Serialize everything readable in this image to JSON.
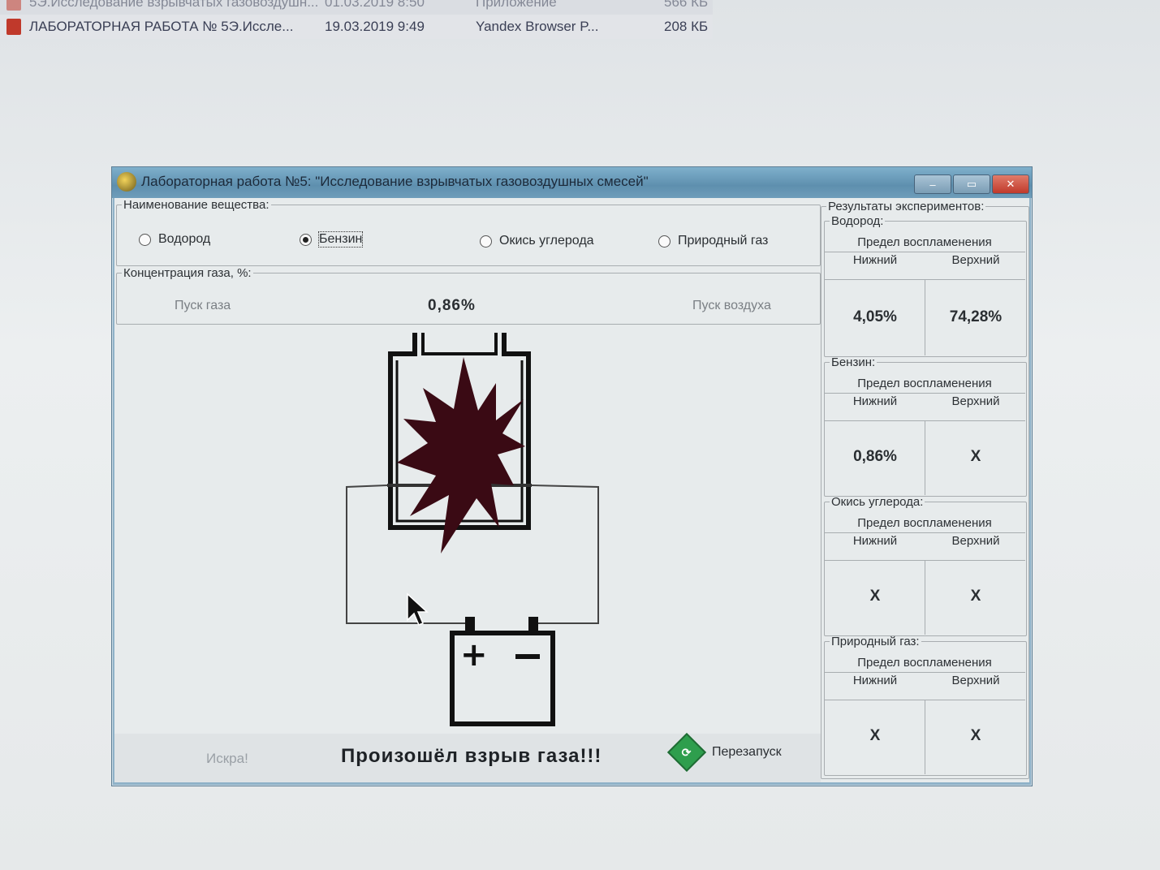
{
  "bg_files": [
    {
      "name": "5Э.Исследование взрывчатых газовоздушн...",
      "date": "01.03.2019 8:50",
      "type": "Приложение",
      "size": "566 КБ"
    },
    {
      "name": "ЛАБОРАТОРНАЯ РАБОТА № 5Э.Иссле...",
      "date": "19.03.2019 9:49",
      "type": "Yandex Browser P...",
      "size": "208 КБ"
    }
  ],
  "window": {
    "title": "Лабораторная работа №5: \"Исследование взрывчатых газовоздушных смесей\"",
    "min": "–",
    "max": "▭",
    "close": "✕"
  },
  "substance": {
    "legend": "Наименование вещества:",
    "options": [
      "Водород",
      "Бензин",
      "Окись углерода",
      "Природный газ"
    ],
    "selected": 1
  },
  "concentration": {
    "legend": "Концентрация газа, %:",
    "gas_button": "Пуск газа",
    "value": "0,86%",
    "air_button": "Пуск воздуха"
  },
  "bottom": {
    "spark": "Искра!",
    "message": "Произошёл взрыв газа!!!",
    "restart": "Перезапуск"
  },
  "results": {
    "legend": "Результаты экспериментов:",
    "limit_label": "Предел воспламенения",
    "lower_label": "Нижний",
    "upper_label": "Верхний",
    "groups": [
      {
        "name": "Водород:",
        "lower": "4,05%",
        "upper": "74,28%"
      },
      {
        "name": "Бензин:",
        "lower": "0,86%",
        "upper": "X"
      },
      {
        "name": "Окись углерода:",
        "lower": "X",
        "upper": "X"
      },
      {
        "name": "Природный газ:",
        "lower": "X",
        "upper": "X"
      }
    ]
  },
  "colors": {
    "explosion": "#3a0a14",
    "restart_icon": "#2e9e4d"
  }
}
